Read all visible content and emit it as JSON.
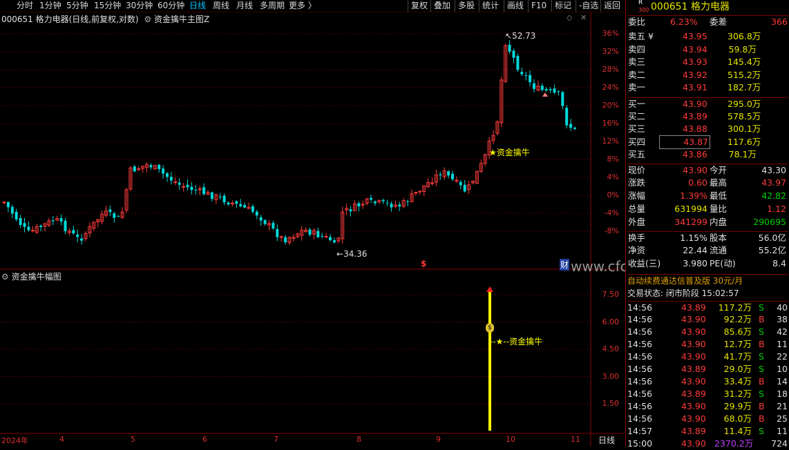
{
  "toolbar": {
    "tabs": [
      "分时",
      "1分钟",
      "5分钟",
      "15分钟",
      "30分钟",
      "60分钟",
      "日线",
      "周线",
      "月线",
      "多周期",
      "更多 〉"
    ],
    "active": "日线",
    "right": [
      "复权",
      "叠加",
      "多股",
      "统计",
      "画线",
      "F10",
      "标记",
      "-自选",
      "返回"
    ]
  },
  "main_chart": {
    "title": "000651 格力电器(日线,前复权,对数)",
    "indicator": "资金擒牛主图Z",
    "y_labels": [
      "36%",
      "32%",
      "28%",
      "24%",
      "20%",
      "16%",
      "12%",
      "8%",
      "4%",
      "0%",
      "-4%",
      "-8%"
    ],
    "high_label": "52.73",
    "low_label": "34.36",
    "signal_label": "★资金擒牛",
    "dollar_marker": "$",
    "finance_marker": "财"
  },
  "sub_chart": {
    "title": "资金擒牛幅图",
    "y_labels": [
      "7.50",
      "6.00",
      "4.50",
      "3.00",
      "1.50"
    ],
    "signal_label": "--★--资金擒牛",
    "bag_icon": "$"
  },
  "x_axis": [
    "2024年",
    "4",
    "5",
    "6",
    "7",
    "8",
    "9",
    "10",
    "11"
  ],
  "period_label": "日线",
  "watermark": "www.cfchf.com",
  "chart_data": {
    "type": "candlestick",
    "title": "000651 格力电器(日线,前复权,对数)",
    "y_axis": "percent change, -8% to 36%",
    "annotations": [
      {
        "label": "52.73",
        "type": "high"
      },
      {
        "label": "34.36",
        "type": "low"
      },
      {
        "label": "★资金擒牛",
        "type": "signal"
      }
    ],
    "sub_series": {
      "name": "资金擒牛幅图",
      "signal_value": 7.5
    }
  },
  "quote": {
    "badge_top": "R",
    "badge_bottom": "300",
    "code": "000651",
    "name": "格力电器",
    "weibi_label": "委比",
    "weibi": "6.23%",
    "weicha_label": "委差",
    "weicha": "366",
    "asks": [
      {
        "label": "卖五 ¥",
        "price": "43.95",
        "vol": "306.8万"
      },
      {
        "label": "卖四",
        "price": "43.94",
        "vol": "59.8万"
      },
      {
        "label": "卖三",
        "price": "43.93",
        "vol": "145.4万"
      },
      {
        "label": "卖二",
        "price": "43.92",
        "vol": "515.2万"
      },
      {
        "label": "卖一",
        "price": "43.91",
        "vol": "182.7万"
      }
    ],
    "bids": [
      {
        "label": "买一",
        "price": "43.90",
        "vol": "295.0万"
      },
      {
        "label": "买二",
        "price": "43.89",
        "vol": "578.5万"
      },
      {
        "label": "买三",
        "price": "43.88",
        "vol": "300.1万"
      },
      {
        "label": "买四",
        "price": "43.87",
        "vol": "117.6万"
      },
      {
        "label": "买五",
        "price": "43.86",
        "vol": "78.1万"
      }
    ],
    "stats": [
      {
        "l1": "现价",
        "v1": "43.90",
        "l2": "今开",
        "v2": "43.30",
        "c1": "red",
        "c2": "white"
      },
      {
        "l1": "涨跌",
        "v1": "0.60",
        "l2": "最高",
        "v2": "43.97",
        "c1": "red",
        "c2": "red"
      },
      {
        "l1": "涨幅",
        "v1": "1.39%",
        "l2": "最低",
        "v2": "42.82",
        "c1": "red",
        "c2": "green"
      },
      {
        "l1": "总量",
        "v1": "631994",
        "l2": "量比",
        "v2": "1.12",
        "c1": "yellow",
        "c2": "red"
      },
      {
        "l1": "外盘",
        "v1": "341299",
        "l2": "内盘",
        "v2": "290695",
        "c1": "red",
        "c2": "green"
      }
    ],
    "stats2": [
      {
        "l1": "换手",
        "v1": "1.15%",
        "l2": "股本",
        "v2": "56.0亿"
      },
      {
        "l1": "净资",
        "v1": "22.44",
        "l2": "流通",
        "v2": "55.2亿"
      },
      {
        "l1": "收益(三)",
        "v1": "3.980",
        "l2": "PE(动)",
        "v2": "8.4"
      }
    ],
    "promo": "自动续费通达信普及版  30元/月",
    "status": "交易状态: 闭市阶段 15:02:57",
    "ticks": [
      {
        "t": "14:56",
        "p": "43.89",
        "v": "117.2万",
        "s": "S",
        "n": "40"
      },
      {
        "t": "14:56",
        "p": "43.90",
        "v": "92.2万",
        "s": "B",
        "n": "38"
      },
      {
        "t": "14:56",
        "p": "43.90",
        "v": "85.6万",
        "s": "S",
        "n": "42"
      },
      {
        "t": "14:56",
        "p": "43.90",
        "v": "12.7万",
        "s": "B",
        "n": "11"
      },
      {
        "t": "14:56",
        "p": "43.90",
        "v": "41.7万",
        "s": "S",
        "n": "22"
      },
      {
        "t": "14:56",
        "p": "43.89",
        "v": "29.0万",
        "s": "S",
        "n": "10"
      },
      {
        "t": "14:56",
        "p": "43.90",
        "v": "33.4万",
        "s": "B",
        "n": "14"
      },
      {
        "t": "14:56",
        "p": "43.89",
        "v": "31.2万",
        "s": "S",
        "n": "18"
      },
      {
        "t": "14:56",
        "p": "43.90",
        "v": "29.9万",
        "s": "B",
        "n": "21"
      },
      {
        "t": "14:56",
        "p": "43.90",
        "v": "68.0万",
        "s": "B",
        "n": "25"
      },
      {
        "t": "14:57",
        "p": "43.89",
        "v": "11.4万",
        "s": "S",
        "n": "11"
      },
      {
        "t": "15:00",
        "p": "43.90",
        "v": "2370.2万",
        "s": "",
        "n": "724"
      }
    ]
  }
}
